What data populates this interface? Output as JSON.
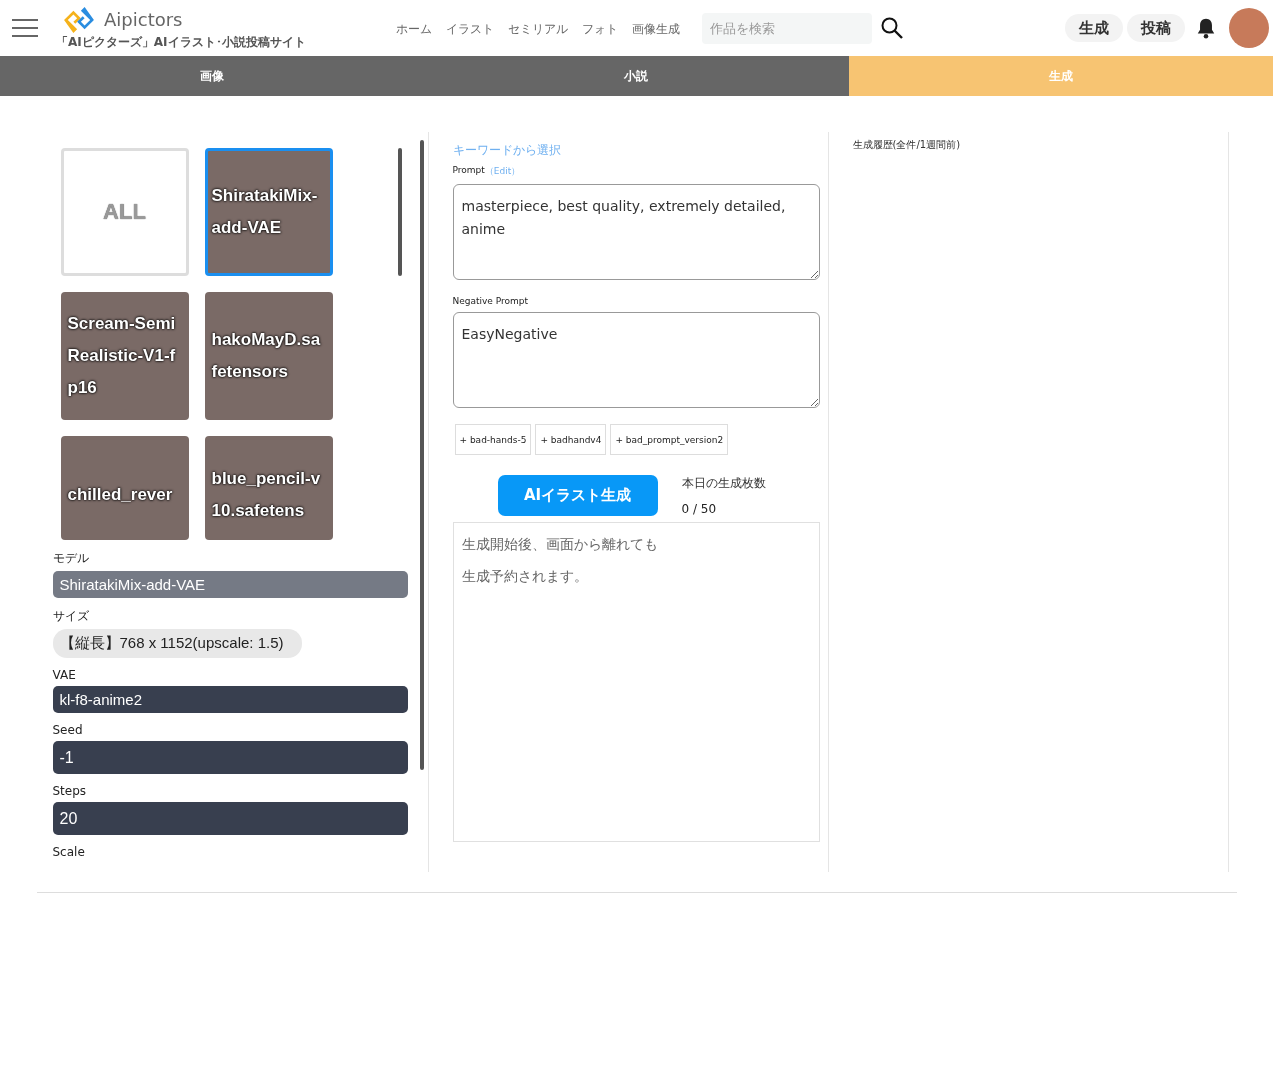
{
  "header": {
    "logo_text": "Aipictors",
    "tagline": "「AIピクターズ」AIイラスト･小説投稿サイト",
    "nav": [
      "ホーム",
      "イラスト",
      "セミリアル",
      "フォト",
      "画像生成"
    ],
    "search": {
      "placeholder": "作品を検索"
    },
    "buttons": [
      "生成",
      "投稿"
    ]
  },
  "tabs": [
    {
      "label": "画像",
      "selected": false
    },
    {
      "label": "小説",
      "selected": false
    },
    {
      "label": "生成",
      "selected": true
    }
  ],
  "models": [
    {
      "kind": "all",
      "label": "ALL",
      "selected": false
    },
    {
      "kind": "image",
      "label": "ShiratakiMix-add-VAE",
      "selected": true
    },
    {
      "kind": "image",
      "label": "Scream-SemiRealistic-V1-fp16",
      "selected": false
    },
    {
      "kind": "image",
      "label": "hakoMayD.safetensors",
      "selected": false
    },
    {
      "kind": "image",
      "label": "chilled_rever",
      "selected": false
    },
    {
      "kind": "image",
      "label": "blue_pencil-v10.safetens",
      "selected": false
    }
  ],
  "settings": [
    {
      "kind": "model",
      "label": "モデル",
      "value": "ShiratakiMix-add-VAE"
    },
    {
      "kind": "size",
      "label": "サイズ",
      "value": "【縦長】768 x 1152(upscale: 1.5)"
    },
    {
      "kind": "select",
      "label": "VAE",
      "value": "kl-f8-anime2"
    },
    {
      "kind": "input",
      "label": "Seed",
      "value": "-1"
    },
    {
      "kind": "input",
      "label": "Steps",
      "value": "20"
    },
    {
      "kind": "label",
      "label": "Scale"
    }
  ],
  "prompt": {
    "keyword_link": "キーワードから選択",
    "label": "Prompt",
    "edit_link": "（Edit）",
    "value": "masterpiece, best quality, extremely detailed, anime"
  },
  "negative_prompt": {
    "label": "Negative Prompt",
    "value": "EasyNegative",
    "chips": [
      "+ bad-hands-5",
      "+ badhandv4",
      "+ bad_prompt_version2"
    ]
  },
  "generate": {
    "button": "AIイラスト生成",
    "count_label": "本日の生成枚数",
    "count": "0 / 50"
  },
  "status_message": [
    "生成開始後、画面から離れても",
    "生成予約されます。"
  ],
  "history": {
    "title": "生成履歴(全件/1週間前)"
  }
}
